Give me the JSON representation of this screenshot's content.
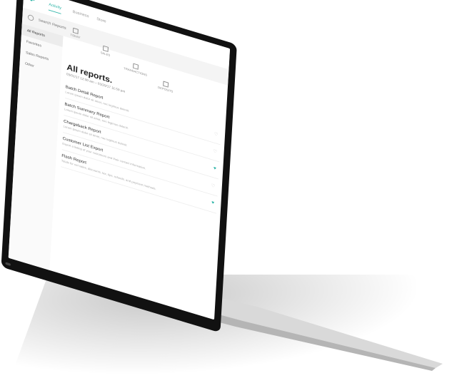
{
  "nav": {
    "tabs": [
      {
        "label": "Activity",
        "active": true
      },
      {
        "label": "Business",
        "active": false
      },
      {
        "label": "Store",
        "active": false
      }
    ]
  },
  "search": {
    "placeholder": "Search Reports"
  },
  "categories": [
    {
      "label": "TODAY",
      "icon": "grid-icon",
      "active": false
    },
    {
      "label": "SALES",
      "icon": "bar-chart-icon",
      "active": false
    },
    {
      "label": "TRANSACTIONS",
      "icon": "transactions-icon",
      "active": false
    },
    {
      "label": "DEPOSITS",
      "icon": "deposits-icon",
      "active": false
    },
    {
      "label": "REPORTS",
      "icon": "reports-icon",
      "active": true
    }
  ],
  "sidebar": {
    "items": [
      {
        "label": "All Reports",
        "active": true
      },
      {
        "label": "Favorites",
        "active": false
      },
      {
        "label": "Sales Reports",
        "active": false
      },
      {
        "label": "Other",
        "active": false
      }
    ]
  },
  "main": {
    "title": "All reports.",
    "date_range": "03/01/17 12:00 am – 03/29/17 11:59 pm",
    "reports": [
      {
        "name": "Batch Detail Report",
        "desc": "Lorem ipsum dolor sit amet, nec legimus delenit.",
        "favorite": false
      },
      {
        "name": "Batch Summary Report",
        "desc": "Lorem ipsum dolor sit amet, nec legimus delenit.",
        "favorite": false
      },
      {
        "name": "Chargeback Report",
        "desc": "Lorem ipsum dolor sit amet, nec legimus delenit.",
        "favorite": true
      },
      {
        "name": "Customer List Export",
        "desc": "Export a listing of your customers and their contact information.",
        "favorite": false
      },
      {
        "name": "Flash Report",
        "desc": "Totals for net sales, discounts, tax, tips, refunds, and payment methods.",
        "favorite": true
      }
    ]
  },
  "colors": {
    "accent": "#2bb3a6"
  }
}
